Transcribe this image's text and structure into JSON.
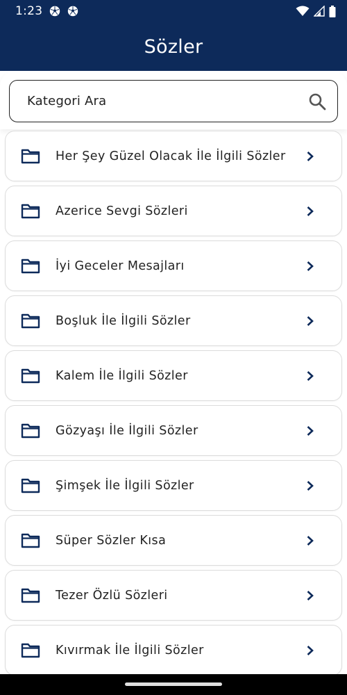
{
  "status": {
    "time": "1:23",
    "left_icons": [
      "soccer-ball-icon",
      "soccer-ball-icon"
    ],
    "right_icons": [
      "wifi-icon",
      "signal-icon",
      "battery-icon"
    ]
  },
  "appbar": {
    "title": "Sözler"
  },
  "search": {
    "placeholder": "Kategori Ara"
  },
  "categories": [
    {
      "label": "Her Şey Güzel Olacak İle İlgili Sözler"
    },
    {
      "label": "Azerice Sevgi Sözleri"
    },
    {
      "label": "İyi Geceler Mesajları"
    },
    {
      "label": "Boşluk İle İlgili Sözler"
    },
    {
      "label": "Kalem İle İlgili Sözler"
    },
    {
      "label": "Gözyaşı İle İlgili Sözler"
    },
    {
      "label": "Şimşek İle İlgili Sözler"
    },
    {
      "label": "Süper Sözler Kısa"
    },
    {
      "label": "Tezer Özlü Sözleri"
    },
    {
      "label": "Kıvırmak İle İlgili Sözler"
    }
  ],
  "colors": {
    "primary": "#0d2a5a",
    "icon": "#0d2a5a",
    "text": "#222222",
    "card_border": "#dcdcdc"
  }
}
